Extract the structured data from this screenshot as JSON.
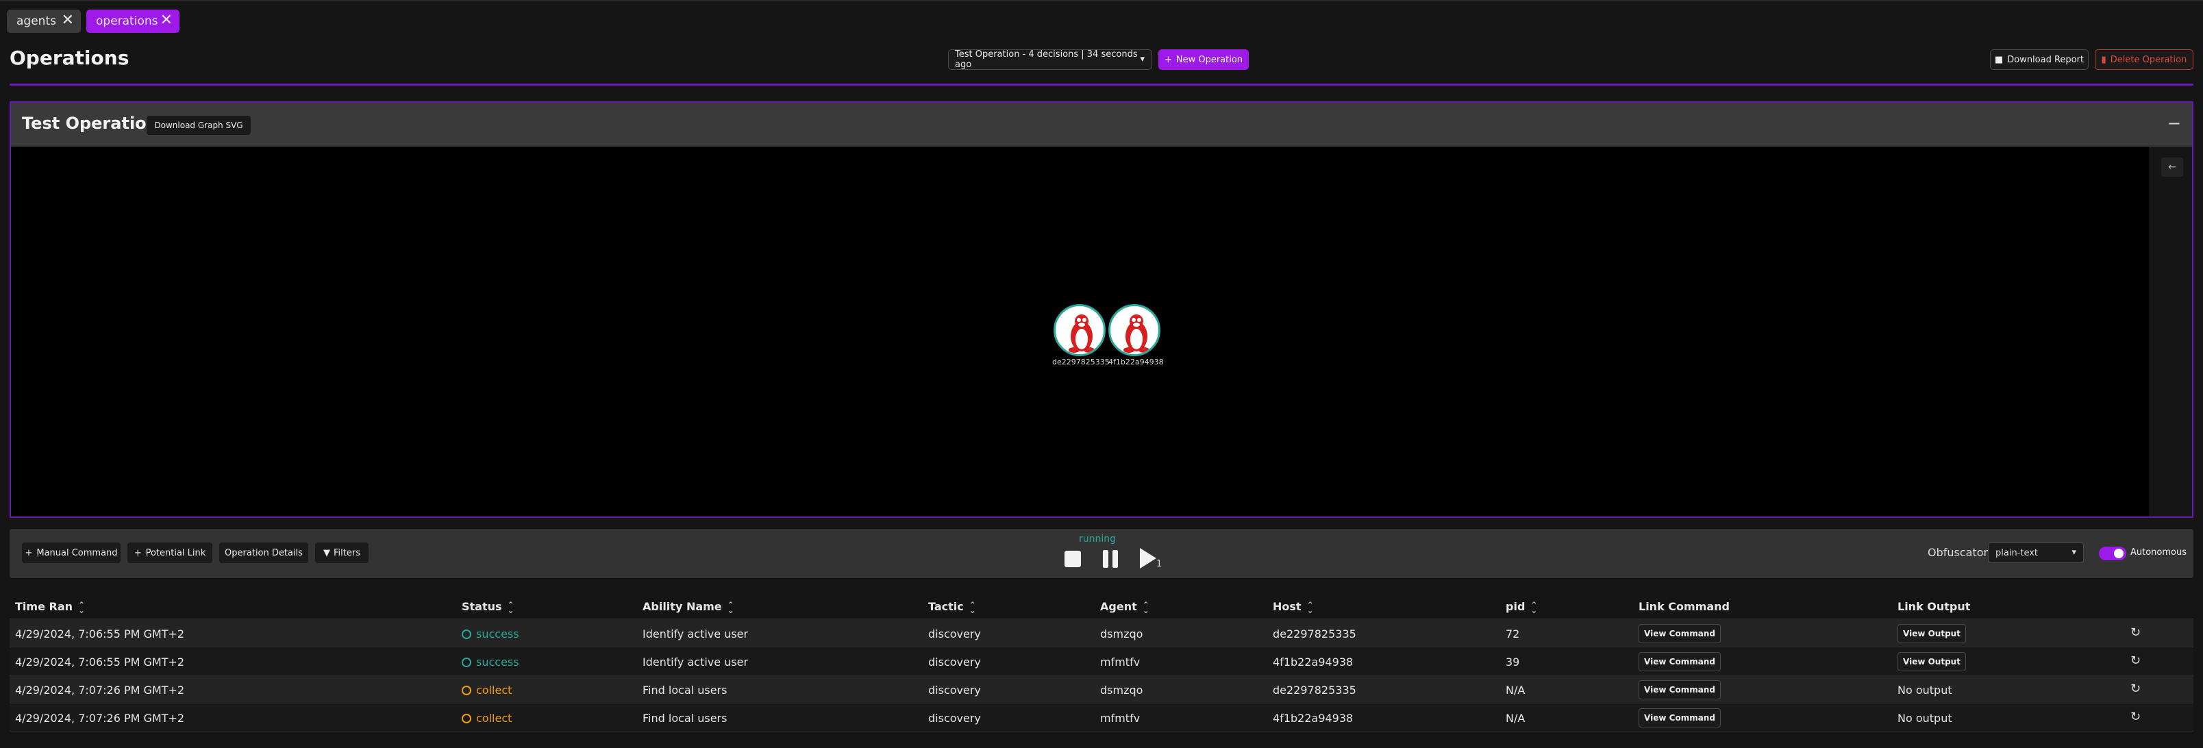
{
  "tabs": [
    {
      "label": "agents",
      "close_glyph": "✕"
    },
    {
      "label": "operations",
      "close_glyph": "✕"
    }
  ],
  "header": {
    "title": "Operations",
    "operation_select": "Test Operation - 4 decisions | 34 seconds ago",
    "new_operation_label": "New Operation",
    "download_report_label": "Download Report",
    "delete_operation_label": "Delete Operation"
  },
  "graph": {
    "title": "Test Operation",
    "download_svg_label": "Download Graph SVG",
    "collapse_glyph": "−",
    "side_toggle_glyph": "←",
    "nodes": [
      {
        "label": "de2297825335",
        "icon": "linux-tux-icon"
      },
      {
        "label": "4f1b22a94938",
        "icon": "linux-tux-icon"
      }
    ]
  },
  "controls": {
    "manual_command_label": "Manual Command",
    "potential_link_label": "Potential Link",
    "operation_details_label": "Operation Details",
    "filters_label": "Filters",
    "state": "running",
    "play_count": "1",
    "obfuscator_label": "Obfuscator:",
    "obfuscator_value": "plain-text",
    "autonomous_label": "Autonomous",
    "autonomous_on": true
  },
  "table": {
    "columns": [
      "Time Ran",
      "Status",
      "Ability Name",
      "Tactic",
      "Agent",
      "Host",
      "pid",
      "Link Command",
      "Link Output"
    ],
    "rows": [
      {
        "time": "4/29/2024, 7:06:55 PM GMT+2",
        "status": "success",
        "ability": "Identify active user",
        "tactic": "discovery",
        "agent": "dsmzqo",
        "host": "de2297825335",
        "pid": "72",
        "command": "View Command",
        "output": "View Output"
      },
      {
        "time": "4/29/2024, 7:06:55 PM GMT+2",
        "status": "success",
        "ability": "Identify active user",
        "tactic": "discovery",
        "agent": "mfmtfv",
        "host": "4f1b22a94938",
        "pid": "39",
        "command": "View Command",
        "output": "View Output"
      },
      {
        "time": "4/29/2024, 7:07:26 PM GMT+2",
        "status": "collect",
        "ability": "Find local users",
        "tactic": "discovery",
        "agent": "dsmzqo",
        "host": "de2297825335",
        "pid": "N/A",
        "command": "View Command",
        "output": "No output"
      },
      {
        "time": "4/29/2024, 7:07:26 PM GMT+2",
        "status": "collect",
        "ability": "Find local users",
        "tactic": "discovery",
        "agent": "mfmtfv",
        "host": "4f1b22a94938",
        "pid": "N/A",
        "command": "View Command",
        "output": "No output"
      }
    ]
  },
  "colors": {
    "accent": "#9e1ae8",
    "success": "#2aa79b",
    "collect": "#f39c12",
    "danger": "#e2483d"
  }
}
